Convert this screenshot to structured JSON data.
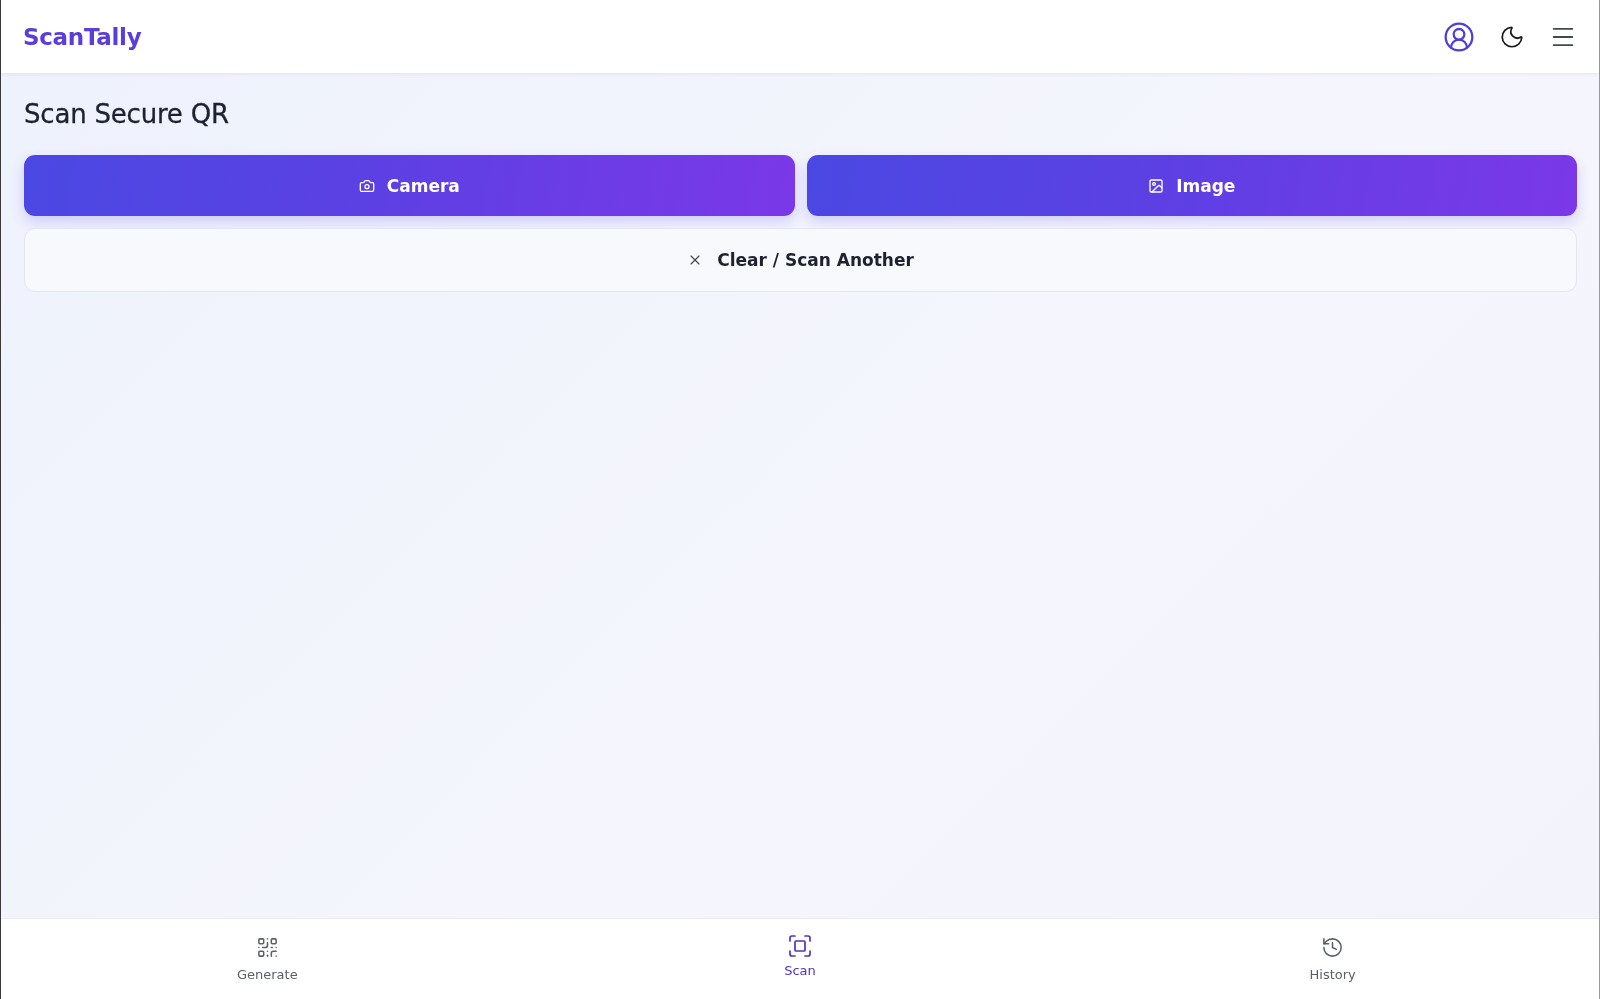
{
  "header": {
    "logo": "ScanTally"
  },
  "page": {
    "title": "Scan Secure QR"
  },
  "actions": [
    {
      "kind": "camera",
      "label": "Camera"
    },
    {
      "kind": "image",
      "label": "Image"
    }
  ],
  "clear_button": {
    "label": "Clear / Scan Another"
  },
  "bottom_nav": [
    {
      "kind": "generate",
      "label": "Generate",
      "selected": false
    },
    {
      "kind": "scan",
      "label": "Scan",
      "selected": true
    },
    {
      "kind": "history",
      "label": "History",
      "selected": false
    }
  ]
}
